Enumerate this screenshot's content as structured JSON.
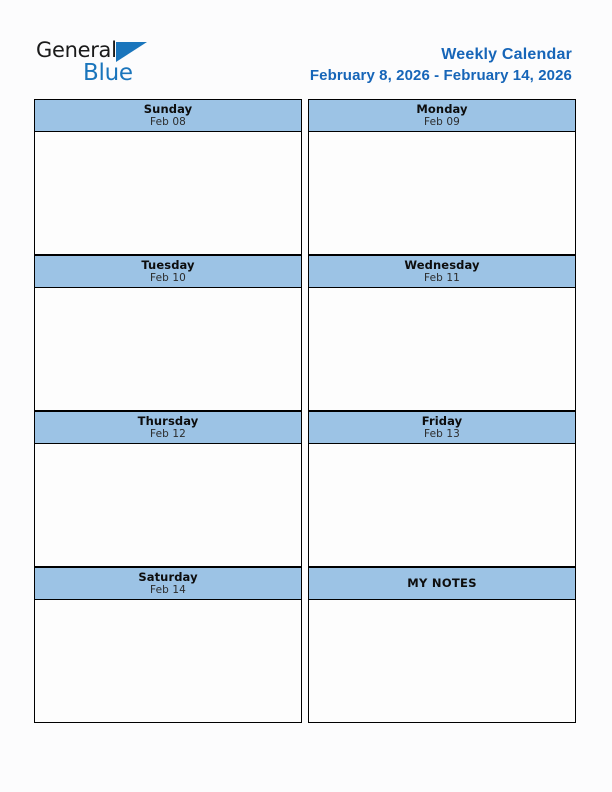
{
  "brand": {
    "name_part1": "General",
    "name_part2": "Blue",
    "flag_icon": "triangle-flag-icon",
    "accent_color": "#1a75bc"
  },
  "header": {
    "title": "Weekly Calendar",
    "date_range": "February 8, 2026 - February 14, 2026",
    "title_color": "#1665b8"
  },
  "calendar": {
    "header_color": "#9cc3e5",
    "border_color": "#000000",
    "cell_color": "#fdfdfd",
    "rows": [
      {
        "left": {
          "day": "Sunday",
          "date": "Feb 08",
          "note": ""
        },
        "right": {
          "day": "Monday",
          "date": "Feb 09",
          "note": ""
        }
      },
      {
        "left": {
          "day": "Tuesday",
          "date": "Feb 10",
          "note": ""
        },
        "right": {
          "day": "Wednesday",
          "date": "Feb 11",
          "note": ""
        }
      },
      {
        "left": {
          "day": "Thursday",
          "date": "Feb 12",
          "note": ""
        },
        "right": {
          "day": "Friday",
          "date": "Feb 13",
          "note": ""
        }
      },
      {
        "left": {
          "day": "Saturday",
          "date": "Feb 14",
          "note": ""
        },
        "right": {
          "day": "MY NOTES",
          "date": "",
          "note": ""
        }
      }
    ]
  }
}
